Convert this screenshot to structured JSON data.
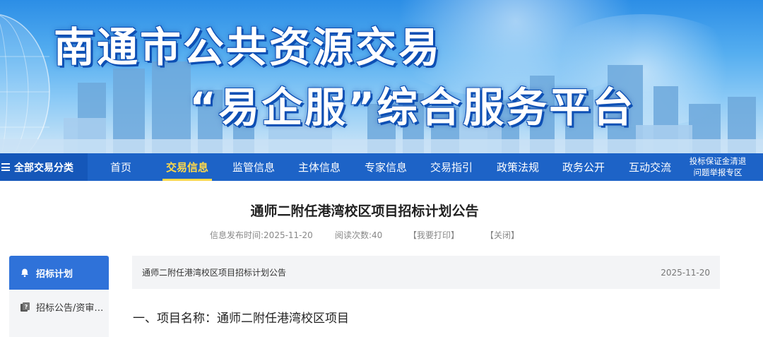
{
  "banner": {
    "line1": "南通市公共资源交易",
    "line2": "“易企服”综合服务平台"
  },
  "nav": {
    "all_categories": "全部交易分类",
    "items": [
      "首页",
      "交易信息",
      "监管信息",
      "主体信息",
      "专家信息",
      "交易指引",
      "政策法规",
      "政务公开",
      "互动交流"
    ],
    "active_index": 1,
    "special_line1": "投标保证金清退",
    "special_line2": "问题举报专区"
  },
  "article": {
    "title": "通师二附任港湾校区项目招标计划公告",
    "publish_time": "信息发布时间:2025-11-20",
    "read_count": "阅读次数:40",
    "print_label": "【我要打印】",
    "close_label": "【关闭】"
  },
  "sidebar": {
    "items": [
      {
        "label": "招标计划",
        "icon": "bell-icon"
      },
      {
        "label": "招标公告/资审…",
        "icon": "document-question-icon"
      }
    ]
  },
  "content": {
    "doc_name": "通师二附任港湾校区项目招标计划公告",
    "doc_date": "2025-11-20",
    "section1": "一、项目名称：通师二附任港湾校区项目"
  },
  "colors": {
    "nav_bg": "#1d63c7",
    "nav_active": "#ffd94a",
    "sidebar_active": "#2f72d9"
  }
}
